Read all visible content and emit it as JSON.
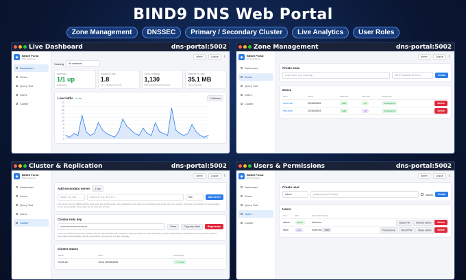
{
  "hero": {
    "title": "BIND9 DNS Web Portal",
    "pills": [
      "Zone Management",
      "DNSSEC",
      "Primary / Secondary Cluster",
      "Live Analytics",
      "User Roles"
    ]
  },
  "app": {
    "brand": "BIND9 Portal",
    "brand_sub": "DNS appliance",
    "user": "admin",
    "logout": "Logout",
    "nav": [
      "Dashboard",
      "Zones",
      "Query Tool",
      "Users",
      "Cluster"
    ]
  },
  "panels": {
    "dashboard": {
      "title": "Live Dashboard",
      "host": "dns-portal:5002",
      "viewing_label": "Viewing",
      "viewing_value": "All combined",
      "stats": [
        {
          "label": "Servers",
          "value": "1/1 up",
          "sub": "appliance-1"
        },
        {
          "label": "Queries / sec",
          "value": "1.8",
          "sub": "live · sampled every 5s"
        },
        {
          "label": "Total queries",
          "value": "1,130",
          "sub": "69% answered with success"
        },
        {
          "label": "Memory in use",
          "value": "35.1 MB",
          "sub": "named process"
        }
      ],
      "traffic_title": "Live traffic",
      "traffic_status": "● Live",
      "refresh": "↻ Refresh",
      "y_ticks": [
        "20",
        "18",
        "16",
        "14",
        "12",
        "10",
        "8",
        "6",
        "4",
        "2",
        "0"
      ]
    },
    "zones": {
      "title": "Zone Management",
      "host": "dns-portal:5002",
      "create_title": "Create zone",
      "zone_placeholder": "zone name, e.g. home.lan",
      "ip_placeholder": "NS IP (default 127.0.0.1)",
      "create_btn": "Create",
      "zones_title": "Zones",
      "cols": [
        "Zone",
        "Serial",
        "Validation",
        "Records",
        "Replication",
        ""
      ],
      "rows": [
        {
          "zone": "home.lan",
          "serial": "2026062306",
          "validation": "valid",
          "records": "ok",
          "replication": "full acquired",
          "action": "Delete"
        },
        {
          "zone": "test.zone",
          "serial": "2026062803",
          "validation": "valid",
          "records": "sff",
          "replication": "full acquired",
          "action": "Delete"
        }
      ]
    },
    "cluster": {
      "title": "Cluster & Replication",
      "host": "dns-portal:5002",
      "add_title": "Add secondary server",
      "add_badge": "1 key",
      "name_ph": "name, e.g. ns2",
      "host_ph": "host or IP, e.g. 10.0.0.3",
      "port": "953",
      "add_btn": "Add server",
      "add_note": "The server must run BIND with the same rndc key as this portal, rndc reachable on the given port, and allow-new-zones yes; in its options. All zones are pushed to it as secondary zones automatically; this portal's server stays the primary.",
      "key_title": "Cluster rndc key",
      "key_value": "••••••••••••••••••••••••••••••••",
      "show": "Show",
      "copy": "Copy key block",
      "regen": "Regenerate",
      "key_note": "This is the shared secret every cluster member authenticates with. Install the copied key block on each secondary you add. Regenerating updates the primary and the portal for secondaries automatically, remote secondaries must get the new key manually.",
      "status_title": "Cluster status",
      "status_cols": [
        "Name",
        "Host",
        "Last Activity"
      ],
      "status_row": {
        "name": "home.lan",
        "host": "serial 2026062306",
        "status": "✓ in sync"
      }
    },
    "users": {
      "title": "Users & Permissions",
      "host": "dns-portal:5002",
      "create_title": "Create user",
      "username_value": "admin",
      "password_ph": "password (min 8 chars)",
      "admin_label": "admin",
      "create_btn": "Create",
      "users_title": "Users",
      "cols": [
        "User",
        "Role",
        "Zone Permissions",
        ""
      ],
      "rows": [
        {
          "user": "admin",
          "role": "admin",
          "perm": "all zones",
          "actions": [
            "Reset PW",
            "Revoke admin",
            "Delete"
          ]
        },
        {
          "user": "ralph",
          "role": "user",
          "perm": "home.lan",
          "perm_tag": "read",
          "actions": [
            "Permissions",
            "Reset PW",
            "Make admin",
            "Delete"
          ]
        }
      ]
    }
  },
  "chart_data": {
    "type": "area",
    "title": "Live traffic",
    "ylim": [
      0,
      20
    ],
    "values": [
      2,
      1,
      3,
      2,
      13,
      4,
      2,
      3,
      9,
      5,
      3,
      2,
      1,
      4,
      11,
      7,
      5,
      3,
      2,
      6,
      3,
      2,
      9,
      4,
      3,
      2,
      17,
      5,
      3,
      2,
      3,
      8,
      4,
      2,
      1,
      2
    ]
  },
  "colors": {
    "accent": "#2b7de9",
    "danger": "#e0283b",
    "success": "#159a45",
    "header": "#1a2238"
  }
}
